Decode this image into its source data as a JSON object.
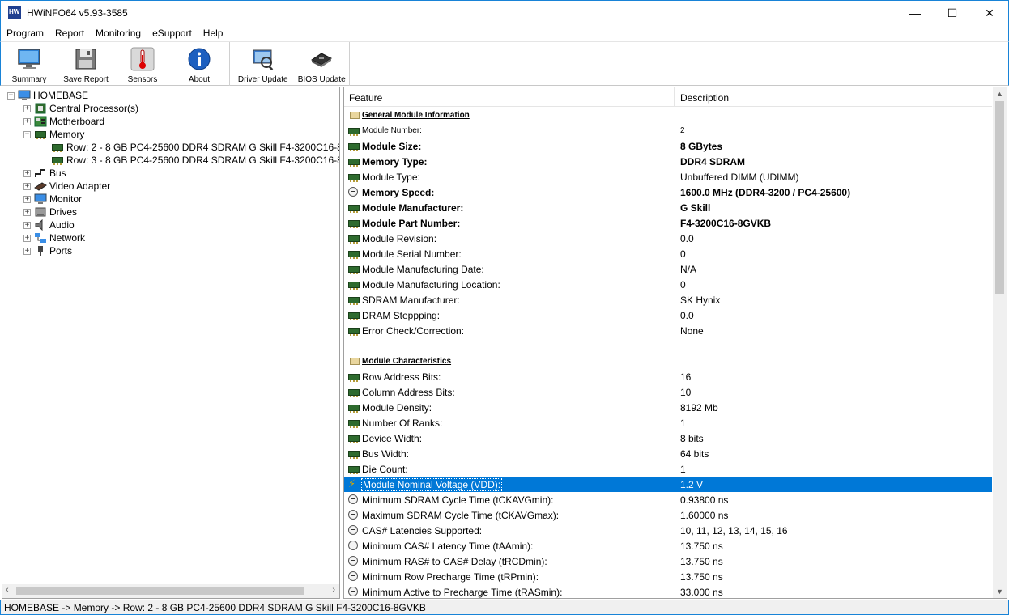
{
  "window": {
    "title": "HWiNFO64 v5.93-3585",
    "minimize_glyph": "—",
    "maximize_glyph": "☐",
    "close_glyph": "✕"
  },
  "menu": [
    "Program",
    "Report",
    "Monitoring",
    "eSupport",
    "Help"
  ],
  "toolbar": {
    "summary": "Summary",
    "save_report": "Save Report",
    "sensors": "Sensors",
    "about": "About",
    "driver_update": "Driver Update",
    "bios_update": "BIOS Update"
  },
  "tree": {
    "root": "HOMEBASE",
    "items": [
      {
        "label": "Central Processor(s)",
        "icon": "cpu-icon"
      },
      {
        "label": "Motherboard",
        "icon": "motherboard-icon"
      },
      {
        "label": "Memory",
        "icon": "memory-icon"
      },
      {
        "label": "Row: 2 - 8 GB PC4-25600 DDR4 SDRAM G Skill F4-3200C16-8",
        "icon": "memory-module-icon"
      },
      {
        "label": "Row: 3 - 8 GB PC4-25600 DDR4 SDRAM G Skill F4-3200C16-8",
        "icon": "memory-module-icon"
      },
      {
        "label": "Bus",
        "icon": "bus-icon"
      },
      {
        "label": "Video Adapter",
        "icon": "video-adapter-icon"
      },
      {
        "label": "Monitor",
        "icon": "monitor-icon"
      },
      {
        "label": "Drives",
        "icon": "drive-icon"
      },
      {
        "label": "Audio",
        "icon": "speaker-icon"
      },
      {
        "label": "Network",
        "icon": "network-icon"
      },
      {
        "label": "Ports",
        "icon": "port-icon"
      }
    ]
  },
  "details": {
    "col_feature": "Feature",
    "col_description": "Description",
    "rows": [
      {
        "type": "section",
        "feature": "General Module Information",
        "desc": ""
      },
      {
        "type": "small",
        "icon": "ram",
        "feature": "Module Number:",
        "desc": "2"
      },
      {
        "type": "bold",
        "icon": "ram",
        "feature": "Module Size:",
        "desc": "8 GBytes"
      },
      {
        "type": "bold",
        "icon": "ram",
        "feature": "Memory Type:",
        "desc": "DDR4 SDRAM"
      },
      {
        "type": "normal",
        "icon": "ram",
        "feature": "Module Type:",
        "desc": "Unbuffered DIMM (UDIMM)"
      },
      {
        "type": "bold",
        "icon": "clock",
        "feature": "Memory Speed:",
        "desc": "1600.0 MHz (DDR4-3200 / PC4-25600)"
      },
      {
        "type": "bold",
        "icon": "ram",
        "feature": "Module Manufacturer:",
        "desc": "G Skill"
      },
      {
        "type": "bold",
        "icon": "ram",
        "feature": "Module Part Number:",
        "desc": "F4-3200C16-8GVKB"
      },
      {
        "type": "normal",
        "icon": "ram",
        "feature": "Module Revision:",
        "desc": "0.0"
      },
      {
        "type": "normal",
        "icon": "ram",
        "feature": "Module Serial Number:",
        "desc": "0"
      },
      {
        "type": "normal",
        "icon": "ram",
        "feature": "Module Manufacturing Date:",
        "desc": "N/A"
      },
      {
        "type": "normal",
        "icon": "ram",
        "feature": "Module Manufacturing Location:",
        "desc": "0"
      },
      {
        "type": "normal",
        "icon": "ram",
        "feature": "SDRAM Manufacturer:",
        "desc": "SK Hynix"
      },
      {
        "type": "normal",
        "icon": "ram",
        "feature": "DRAM Steppping:",
        "desc": "0.0"
      },
      {
        "type": "normal",
        "icon": "ram",
        "feature": "Error Check/Correction:",
        "desc": "None"
      },
      {
        "type": "blank",
        "feature": "",
        "desc": ""
      },
      {
        "type": "section",
        "feature": "Module Characteristics",
        "desc": ""
      },
      {
        "type": "normal",
        "icon": "ram",
        "feature": "Row Address Bits:",
        "desc": "16"
      },
      {
        "type": "normal",
        "icon": "ram",
        "feature": "Column Address Bits:",
        "desc": "10"
      },
      {
        "type": "normal",
        "icon": "ram",
        "feature": "Module Density:",
        "desc": "8192 Mb"
      },
      {
        "type": "normal",
        "icon": "ram",
        "feature": "Number Of Ranks:",
        "desc": "1"
      },
      {
        "type": "normal",
        "icon": "ram",
        "feature": "Device Width:",
        "desc": "8 bits"
      },
      {
        "type": "normal",
        "icon": "ram",
        "feature": "Bus Width:",
        "desc": "64 bits"
      },
      {
        "type": "normal",
        "icon": "ram",
        "feature": "Die Count:",
        "desc": "1"
      },
      {
        "type": "selected",
        "icon": "volt",
        "feature": "Module Nominal Voltage (VDD):",
        "desc": "1.2 V"
      },
      {
        "type": "normal",
        "icon": "clock",
        "feature": "Minimum SDRAM Cycle Time (tCKAVGmin):",
        "desc": "0.93800 ns"
      },
      {
        "type": "normal",
        "icon": "clock",
        "feature": "Maximum SDRAM Cycle Time (tCKAVGmax):",
        "desc": "1.60000 ns"
      },
      {
        "type": "normal",
        "icon": "clock",
        "feature": "CAS# Latencies Supported:",
        "desc": "10, 11, 12, 13, 14, 15, 16"
      },
      {
        "type": "normal",
        "icon": "clock",
        "feature": "Minimum CAS# Latency Time (tAAmin):",
        "desc": "13.750 ns"
      },
      {
        "type": "normal",
        "icon": "clock",
        "feature": "Minimum RAS# to CAS# Delay (tRCDmin):",
        "desc": "13.750 ns"
      },
      {
        "type": "normal",
        "icon": "clock",
        "feature": "Minimum Row Precharge Time (tRPmin):",
        "desc": "13.750 ns"
      },
      {
        "type": "normal",
        "icon": "clock",
        "feature": "Minimum Active to Precharge Time (tRASmin):",
        "desc": "33.000 ns"
      }
    ]
  },
  "statusbar": {
    "text": "HOMEBASE -> Memory -> Row: 2 - 8 GB PC4-25600 DDR4 SDRAM G Skill F4-3200C16-8GVKB"
  },
  "colors": {
    "selection": "#0078d7",
    "window_border": "#1883d7"
  }
}
